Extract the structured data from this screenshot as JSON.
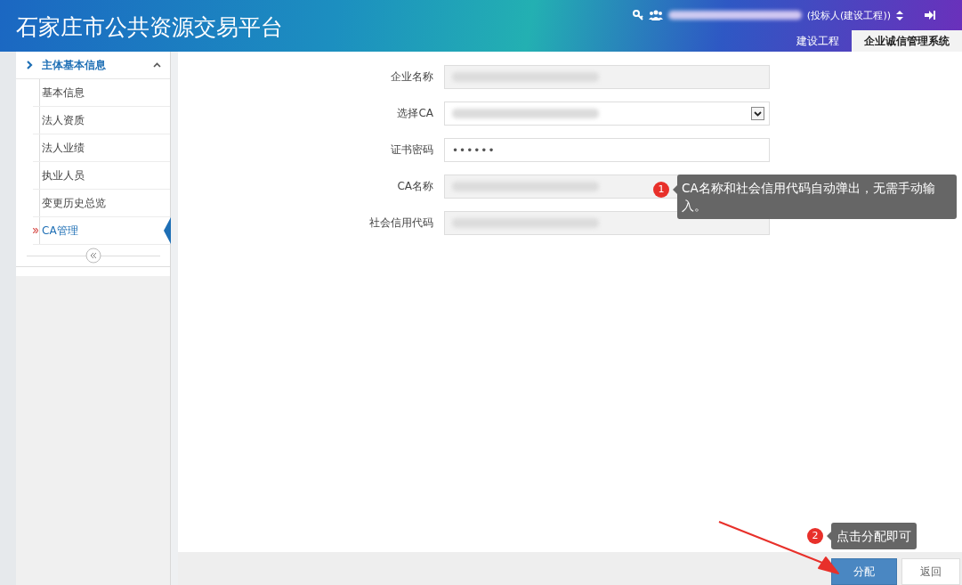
{
  "header": {
    "title": "石家庄市公共资源交易平台",
    "user": {
      "redacted": true,
      "role": "(投标人(建设工程))"
    },
    "tabs": [
      {
        "label": "建设工程",
        "selected": false
      },
      {
        "label": "企业诚信管理系统",
        "selected": true
      }
    ]
  },
  "sidebar": {
    "group": {
      "label": "主体基本信息",
      "expanded": true
    },
    "items": [
      {
        "label": "基本信息",
        "selected": false
      },
      {
        "label": "法人资质",
        "selected": false
      },
      {
        "label": "法人业绩",
        "selected": false
      },
      {
        "label": "执业人员",
        "selected": false
      },
      {
        "label": "变更历史总览",
        "selected": false
      },
      {
        "label": "CA管理",
        "selected": true
      }
    ]
  },
  "form": {
    "fields": [
      {
        "label": "企业名称",
        "kind": "text",
        "readonly": true,
        "redacted": true
      },
      {
        "label": "选择CA",
        "kind": "select",
        "readonly": false,
        "redacted": true
      },
      {
        "label": "证书密码",
        "kind": "password",
        "readonly": false,
        "redacted": false,
        "value": "••••••"
      },
      {
        "label": "CA名称",
        "kind": "text",
        "readonly": true,
        "redacted": true
      },
      {
        "label": "社会信用代码",
        "kind": "text",
        "readonly": true,
        "redacted": true
      }
    ]
  },
  "buttons": [
    {
      "label": "分配",
      "kind": "primary"
    },
    {
      "label": "返回",
      "kind": "default"
    }
  ],
  "annotations": [
    {
      "number": "1",
      "text": "CA名称和社会信用代码自动弹出，无需手动输入。"
    },
    {
      "number": "2",
      "text": "点击分配即可"
    }
  ]
}
